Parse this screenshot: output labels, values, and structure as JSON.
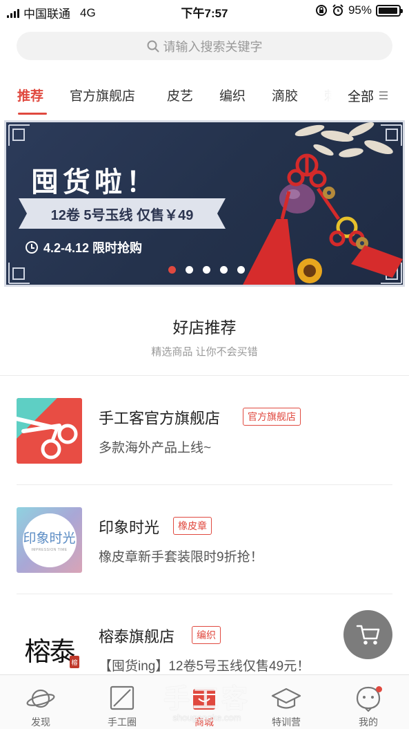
{
  "status_bar": {
    "carrier": "中国联通",
    "network": "4G",
    "time": "下午7:57",
    "battery_percent": "95%",
    "battery_level": 0.95
  },
  "search": {
    "placeholder": "请输入搜索关键字"
  },
  "tabs": {
    "items": [
      {
        "label": "推荐",
        "active": true
      },
      {
        "label": "官方旗舰店"
      },
      {
        "label": "皮艺"
      },
      {
        "label": "编织"
      },
      {
        "label": "滴胶"
      },
      {
        "label": "刺"
      }
    ],
    "all_label": "全部"
  },
  "banner": {
    "title": "囤货啦！",
    "ribbon": "12卷 5号玉线 仅售￥49",
    "date_text": "4.2-4.12  限时抢购",
    "slide_count": 5,
    "active_slide": 1
  },
  "section": {
    "title": "好店推荐",
    "subtitle": "精选商品 让你不会买错"
  },
  "shops": [
    {
      "name": "手工客官方旗舰店",
      "tag": "官方旗舰店",
      "desc": "多款海外产品上线~",
      "thumb": "scissors-logo"
    },
    {
      "name": "印象时光",
      "tag": "橡皮章",
      "desc": "橡皮章新手套装限时9折抢！",
      "thumb_text": "印象时光",
      "thumb_subtext": "IMPRESSION TIME"
    },
    {
      "name": "榕泰旗舰店",
      "tag": "编织",
      "desc": "【囤货ing】12卷5号玉线仅售49元！",
      "thumb_text": "榕泰",
      "thumb_seal": "榕"
    }
  ],
  "cart": {
    "icon": "cart-icon"
  },
  "bottom_nav": {
    "items": [
      {
        "label": "发现",
        "icon": "planet-icon"
      },
      {
        "label": "手工圈",
        "icon": "square-slash-icon"
      },
      {
        "label": "商城",
        "icon": "shop-icon",
        "active": true
      },
      {
        "label": "特训营",
        "icon": "graduation-cap-icon"
      },
      {
        "label": "我的",
        "icon": "profile-icon",
        "badge": true
      }
    ]
  },
  "watermark": {
    "title": "手工客",
    "url": "shougongke.com"
  },
  "colors": {
    "accent": "#e0493f",
    "banner_bg": "#2c3b5a"
  }
}
